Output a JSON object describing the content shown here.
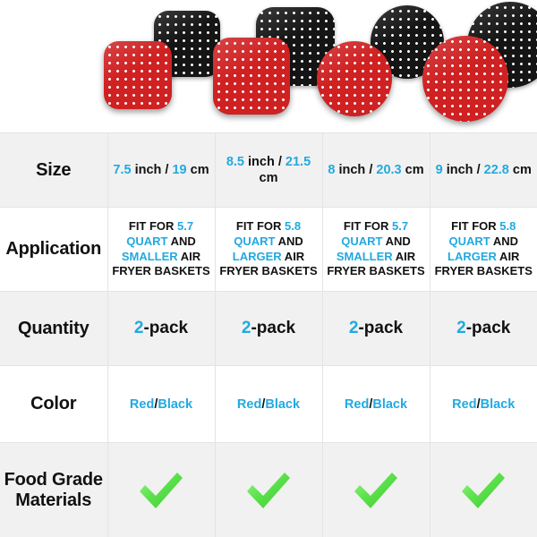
{
  "products": [
    {
      "name": "7.5 inch square perforated air fryer liner set",
      "shape": "square",
      "back_color": "#151515",
      "front_color": "#cf2122"
    },
    {
      "name": "8.5 inch square perforated air fryer liner set",
      "shape": "square",
      "back_color": "#151515",
      "front_color": "#cf2122"
    },
    {
      "name": "8 inch round perforated air fryer liner set",
      "shape": "circle",
      "back_color": "#151515",
      "front_color": "#cf2122"
    },
    {
      "name": "9 inch round perforated air fryer liner set",
      "shape": "circle",
      "back_color": "#151515",
      "front_color": "#cf2122"
    }
  ],
  "accent_color": "#22a9e0",
  "check_color": "#5ae04a",
  "table": {
    "rows": [
      {
        "label": "Size",
        "cells": [
          {
            "parts": [
              {
                "text": "7.5",
                "accent": true
              },
              {
                "text": " inch / ",
                "accent": false
              },
              {
                "text": "19",
                "accent": true
              },
              {
                "text": " cm",
                "accent": false
              }
            ]
          },
          {
            "parts": [
              {
                "text": "8.5",
                "accent": true
              },
              {
                "text": " inch / ",
                "accent": false
              },
              {
                "text": "21.5",
                "accent": true
              },
              {
                "text": " cm",
                "accent": false
              }
            ]
          },
          {
            "parts": [
              {
                "text": "8",
                "accent": true
              },
              {
                "text": " inch / ",
                "accent": false
              },
              {
                "text": "20.3",
                "accent": true
              },
              {
                "text": " cm",
                "accent": false
              }
            ]
          },
          {
            "parts": [
              {
                "text": "9",
                "accent": true
              },
              {
                "text": " inch / ",
                "accent": false
              },
              {
                "text": "22.8",
                "accent": true
              },
              {
                "text": " cm",
                "accent": false
              }
            ]
          }
        ]
      },
      {
        "label": "Application",
        "cells": [
          {
            "parts": [
              {
                "text": "FIT FOR ",
                "accent": false
              },
              {
                "text": "5.7 QUART",
                "accent": true
              },
              {
                "text": " AND ",
                "accent": false
              },
              {
                "text": "SMALLER",
                "accent": true
              },
              {
                "text": " AIR FRYER BASKETS",
                "accent": false
              }
            ]
          },
          {
            "parts": [
              {
                "text": "FIT FOR ",
                "accent": false
              },
              {
                "text": "5.8 QUART",
                "accent": true
              },
              {
                "text": " AND ",
                "accent": false
              },
              {
                "text": "LARGER",
                "accent": true
              },
              {
                "text": " AIR FRYER BASKETS",
                "accent": false
              }
            ]
          },
          {
            "parts": [
              {
                "text": "FIT FOR ",
                "accent": false
              },
              {
                "text": "5.7 QUART",
                "accent": true
              },
              {
                "text": " AND ",
                "accent": false
              },
              {
                "text": "SMALLER",
                "accent": true
              },
              {
                "text": " AIR FRYER BASKETS",
                "accent": false
              }
            ]
          },
          {
            "parts": [
              {
                "text": "FIT FOR ",
                "accent": false
              },
              {
                "text": "5.8 QUART",
                "accent": true
              },
              {
                "text": " AND ",
                "accent": false
              },
              {
                "text": "LARGER",
                "accent": true
              },
              {
                "text": " AIR FRYER BASKETS",
                "accent": false
              }
            ]
          }
        ]
      },
      {
        "label": "Quantity",
        "cells": [
          {
            "parts": [
              {
                "text": "2",
                "accent": true
              },
              {
                "text": "-pack",
                "accent": false
              }
            ]
          },
          {
            "parts": [
              {
                "text": "2",
                "accent": true
              },
              {
                "text": "-pack",
                "accent": false
              }
            ]
          },
          {
            "parts": [
              {
                "text": "2",
                "accent": true
              },
              {
                "text": "-pack",
                "accent": false
              }
            ]
          },
          {
            "parts": [
              {
                "text": "2",
                "accent": true
              },
              {
                "text": "-pack",
                "accent": false
              }
            ]
          }
        ]
      },
      {
        "label": "Color",
        "cells": [
          {
            "parts": [
              {
                "text": "Red",
                "accent": true
              },
              {
                "text": "/",
                "accent": false
              },
              {
                "text": "Black",
                "accent": true
              }
            ]
          },
          {
            "parts": [
              {
                "text": "Red",
                "accent": true
              },
              {
                "text": "/",
                "accent": false
              },
              {
                "text": "Black",
                "accent": true
              }
            ]
          },
          {
            "parts": [
              {
                "text": "Red",
                "accent": true
              },
              {
                "text": "/",
                "accent": false
              },
              {
                "text": "Black",
                "accent": true
              }
            ]
          },
          {
            "parts": [
              {
                "text": "Red",
                "accent": true
              },
              {
                "text": "/",
                "accent": false
              },
              {
                "text": "Black",
                "accent": true
              }
            ]
          }
        ]
      },
      {
        "label": "Food Grade Materials",
        "cells": [
          {
            "icon": "check-icon"
          },
          {
            "icon": "check-icon"
          },
          {
            "icon": "check-icon"
          },
          {
            "icon": "check-icon"
          }
        ]
      }
    ]
  }
}
